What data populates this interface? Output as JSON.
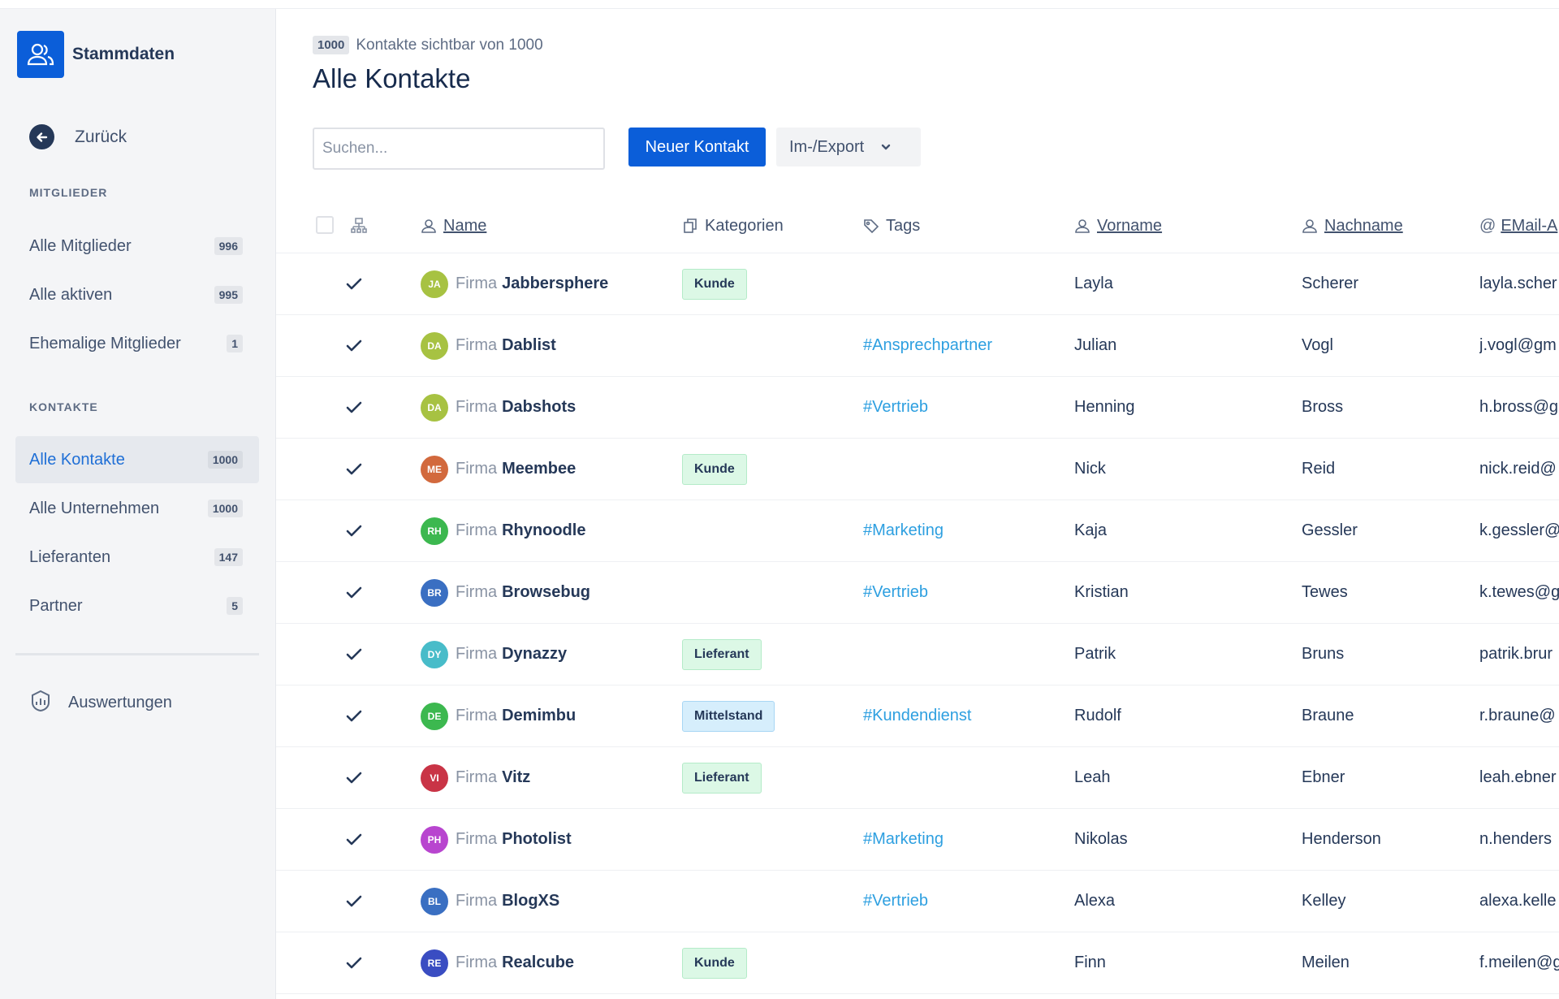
{
  "sidebar": {
    "app_title": "Stammdaten",
    "back_label": "Zurück",
    "sections": [
      {
        "title": "MITGLIEDER",
        "items": [
          {
            "label": "Alle Mitglieder",
            "count": "996"
          },
          {
            "label": "Alle aktiven",
            "count": "995"
          },
          {
            "label": "Ehemalige Mitglieder",
            "count": "1"
          }
        ]
      },
      {
        "title": "KONTAKTE",
        "items": [
          {
            "label": "Alle Kontakte",
            "count": "1000",
            "active": true
          },
          {
            "label": "Alle Unternehmen",
            "count": "1000"
          },
          {
            "label": "Lieferanten",
            "count": "147"
          },
          {
            "label": "Partner",
            "count": "5"
          }
        ]
      }
    ],
    "reports_label": "Auswertungen"
  },
  "header": {
    "visible_count": "1000",
    "subtitle": "Kontakte sichtbar von 1000",
    "title": "Alle Kontakte"
  },
  "toolbar": {
    "search_placeholder": "Suchen...",
    "new_contact_label": "Neuer Kontakt",
    "import_export_label": "Im-/Export"
  },
  "table": {
    "columns": {
      "name": "Name",
      "categories": "Kategorien",
      "tags": "Tags",
      "firstname": "Vorname",
      "lastname": "Nachname",
      "email": "EMail-A"
    },
    "company_prefix": "Firma",
    "rows": [
      {
        "initials": "JA",
        "color": "#a7c242",
        "company": "Jabbersphere",
        "category": "Kunde",
        "category_style": "green",
        "tag": "",
        "firstname": "Layla",
        "lastname": "Scherer",
        "email": "layla.scher"
      },
      {
        "initials": "DA",
        "color": "#a7c242",
        "company": "Dablist",
        "category": "",
        "category_style": "",
        "tag": "#Ansprechpartner",
        "firstname": "Julian",
        "lastname": "Vogl",
        "email": "j.vogl@gm"
      },
      {
        "initials": "DA",
        "color": "#a7c242",
        "company": "Dabshots",
        "category": "",
        "category_style": "",
        "tag": "#Vertrieb",
        "firstname": "Henning",
        "lastname": "Bross",
        "email": "h.bross@g"
      },
      {
        "initials": "ME",
        "color": "#d2693d",
        "company": "Meembee",
        "category": "Kunde",
        "category_style": "green",
        "tag": "",
        "firstname": "Nick",
        "lastname": "Reid",
        "email": "nick.reid@"
      },
      {
        "initials": "RH",
        "color": "#3cb84f",
        "company": "Rhynoodle",
        "category": "",
        "category_style": "",
        "tag": "#Marketing",
        "firstname": "Kaja",
        "lastname": "Gessler",
        "email": "k.gessler@"
      },
      {
        "initials": "BR",
        "color": "#3a6fc2",
        "company": "Browsebug",
        "category": "",
        "category_style": "",
        "tag": "#Vertrieb",
        "firstname": "Kristian",
        "lastname": "Tewes",
        "email": "k.tewes@g"
      },
      {
        "initials": "DY",
        "color": "#48bcc9",
        "company": "Dynazzy",
        "category": "Lieferant",
        "category_style": "green",
        "tag": "",
        "firstname": "Patrik",
        "lastname": "Bruns",
        "email": "patrik.brur"
      },
      {
        "initials": "DE",
        "color": "#3cb84f",
        "company": "Demimbu",
        "category": "Mittelstand",
        "category_style": "blue",
        "tag": "#Kundendienst",
        "firstname": "Rudolf",
        "lastname": "Braune",
        "email": "r.braune@"
      },
      {
        "initials": "VI",
        "color": "#c93446",
        "company": "Vitz",
        "category": "Lieferant",
        "category_style": "green",
        "tag": "",
        "firstname": "Leah",
        "lastname": "Ebner",
        "email": "leah.ebner"
      },
      {
        "initials": "PH",
        "color": "#b845cf",
        "company": "Photolist",
        "category": "",
        "category_style": "",
        "tag": "#Marketing",
        "firstname": "Nikolas",
        "lastname": "Henderson",
        "email": "n.henders"
      },
      {
        "initials": "BL",
        "color": "#3a6fc2",
        "company": "BlogXS",
        "category": "",
        "category_style": "",
        "tag": "#Vertrieb",
        "firstname": "Alexa",
        "lastname": "Kelley",
        "email": "alexa.kelle"
      },
      {
        "initials": "RE",
        "color": "#3a4dc2",
        "company": "Realcube",
        "category": "Kunde",
        "category_style": "green",
        "tag": "",
        "firstname": "Finn",
        "lastname": "Meilen",
        "email": "f.meilen@g"
      }
    ]
  },
  "colors": {
    "primary": "#0b5ed9",
    "tag_link": "#2d9fe0",
    "active_nav": "#1f6fd6"
  }
}
